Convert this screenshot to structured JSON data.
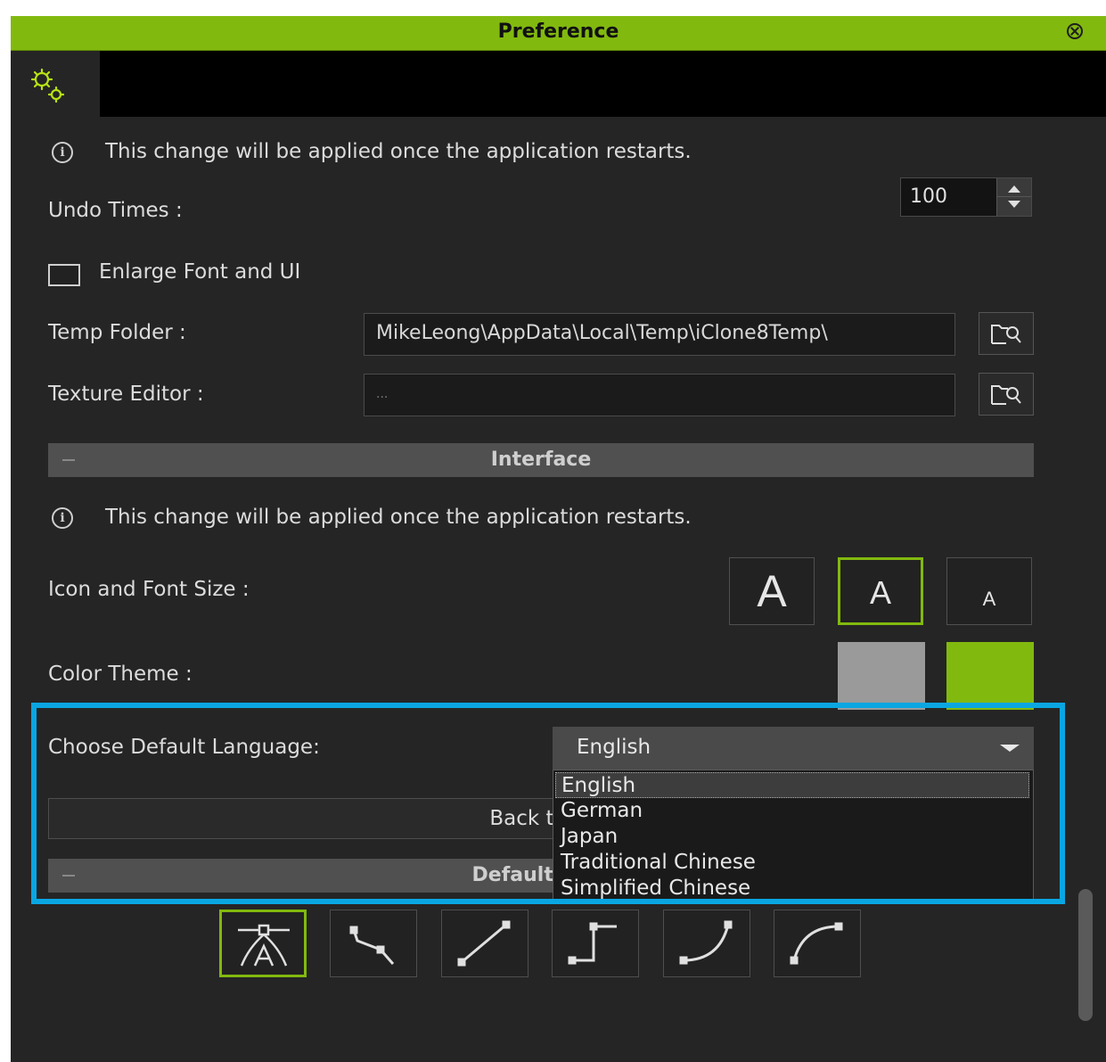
{
  "window": {
    "title": "Preference"
  },
  "notice_text": "This change will be applied once the application restarts.",
  "general": {
    "undo_label": "Undo Times :",
    "undo_value": "100",
    "enlarge_label": "Enlarge Font and UI",
    "enlarge_checked": false,
    "temp_folder_label": "Temp Folder :",
    "temp_folder_value": "MikeLeong\\AppData\\Local\\Temp\\iClone8Temp\\",
    "texture_editor_label": "Texture Editor :",
    "texture_editor_value": "..."
  },
  "interface": {
    "section_title": "Interface",
    "notice_text": "This change will be applied once the application restarts.",
    "icon_font_size_label": "Icon and Font Size :",
    "size_options": [
      {
        "glyph": "A",
        "selected": false
      },
      {
        "glyph": "A",
        "selected": true
      },
      {
        "glyph": "A",
        "selected": false
      }
    ],
    "color_theme_label": "Color Theme :",
    "color_themes": [
      "#9a9a9a",
      "#82b90f"
    ],
    "language_label": "Choose Default Language:",
    "language_value": "English",
    "language_options": [
      "English",
      "German",
      "Japan",
      "Traditional Chinese",
      "Simplified Chinese"
    ],
    "language_highlighted": "English",
    "back_to_default_label": "Back to D"
  },
  "keys": {
    "section_title": "Default Key"
  },
  "colors": {
    "accent": "#82b90f",
    "annotation_frame": "#0aa6e2",
    "panel_bg": "#252525"
  },
  "icons": {
    "tab": "gears-icon",
    "info": "info-icon",
    "browse": "folder-browse-icon",
    "close": "close-circle-icon",
    "tools": [
      "auto-tangent-icon",
      "step-curve-icon",
      "linear-curve-icon",
      "constant-curve-icon",
      "ease-in-icon",
      "ease-out-icon"
    ]
  }
}
